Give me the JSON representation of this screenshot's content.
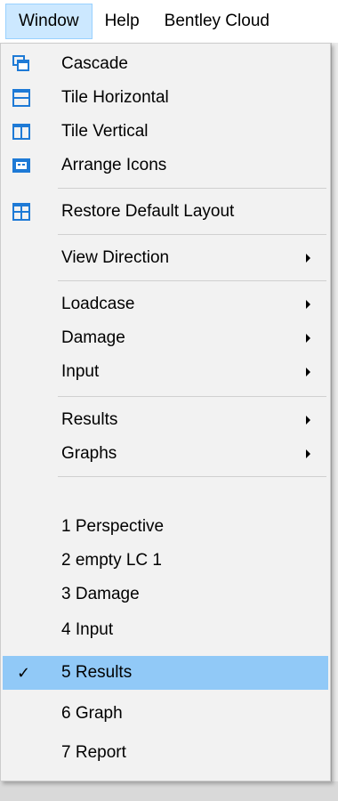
{
  "menubar": {
    "items": [
      {
        "label": "Window",
        "active": true
      },
      {
        "label": "Help"
      },
      {
        "label": "Bentley Cloud"
      }
    ]
  },
  "menu": {
    "items": [
      {
        "label": "Cascade",
        "icon": "cascade-icon"
      },
      {
        "label": "Tile Horizontal",
        "icon": "tile-horizontal-icon"
      },
      {
        "label": "Tile Vertical",
        "icon": "tile-vertical-icon"
      },
      {
        "label": "Arrange Icons",
        "icon": "arrange-icons-icon"
      },
      {
        "label": "Restore Default Layout",
        "icon": "restore-layout-icon"
      },
      {
        "label": "View Direction",
        "submenu": true
      },
      {
        "label": "Loadcase",
        "submenu": true
      },
      {
        "label": "Damage",
        "submenu": true
      },
      {
        "label": "Input",
        "submenu": true
      },
      {
        "label": "Results",
        "submenu": true
      },
      {
        "label": "Graphs",
        "submenu": true
      },
      {
        "label": "1 Perspective"
      },
      {
        "label": "2 empty LC 1"
      },
      {
        "label": "3 Damage"
      },
      {
        "label": "4 Input"
      },
      {
        "label": "5 Results",
        "checked": true,
        "selected": true
      },
      {
        "label": "6 Graph"
      },
      {
        "label": "7 Report"
      }
    ]
  },
  "colors": {
    "icon_blue": "#1e7ad6",
    "selected_bg": "#91c9f7",
    "menubar_active_bg": "#cce8ff"
  }
}
